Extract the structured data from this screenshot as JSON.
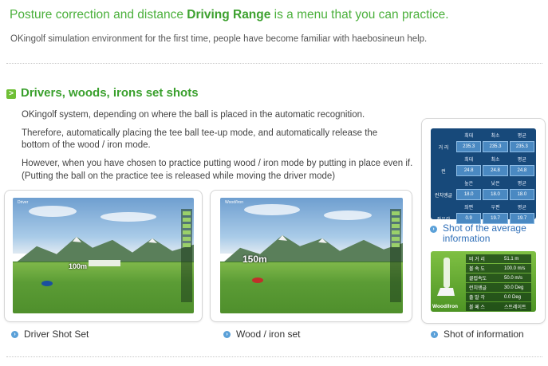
{
  "header": {
    "headline_pre": "Posture correction and distance ",
    "headline_bold": "Driving Range",
    "headline_post": " is a menu that you can practice.",
    "subline": "OKingolf simulation environment for the first time, people have become familiar with haebosineun help."
  },
  "section": {
    "icon": "arrow-right-icon",
    "icon_glyph": ">",
    "title": "Drivers, woods, irons set shots",
    "paragraphs": [
      "OKingolf system, depending on where the ball is placed in the automatic recognition.",
      "Therefore, automatically placing the tee ball tee-up mode, and automatically release the",
      "bottom of the wood / iron mode.",
      "However, when you have chosen to practice putting wood / iron mode by putting in place even if.",
      "(Putting the ball on the practice tee is released while moving the driver mode)"
    ]
  },
  "shots": [
    {
      "caption": "Driver Shot Set",
      "distance_label": "100m",
      "hud_label": "Driver"
    },
    {
      "caption": "Wood / iron set",
      "distance_label": "150m",
      "hud_label": "Wood/Iron"
    }
  ],
  "average": {
    "caption_line1": "Shot of the average",
    "caption_line2": "information",
    "col_headers": [
      "최대",
      "최소",
      "평균"
    ],
    "rows": [
      {
        "label": "거 리",
        "values": [
          "235.3",
          "235.3",
          "235.3"
        ]
      },
      {
        "label": "",
        "values": [
          "",
          "",
          ""
        ]
      },
      {
        "label": "런",
        "values": [
          "24.8",
          "24.8",
          "24.8"
        ]
      },
      {
        "label": "",
        "values": [
          "높은",
          "낮은",
          "평균"
        ]
      },
      {
        "label": "런치앵글",
        "values": [
          "18.0",
          "18.0",
          "18.0"
        ]
      },
      {
        "label": "",
        "values": [
          "좌편",
          "우편",
          "평균"
        ]
      },
      {
        "label": "좌우각",
        "values": [
          "0.9",
          "19.7",
          "19.7"
        ]
      }
    ]
  },
  "info": {
    "caption": "Shot of information",
    "club_label": "Wood/Iron",
    "rows": [
      {
        "label": "비 거 리",
        "value": "51.1 m"
      },
      {
        "label": "볼 속 도",
        "value": "100.0 m/s"
      },
      {
        "label": "클럽속도",
        "value": "50.0 m/s"
      },
      {
        "label": "런치앵글",
        "value": "30.0 Deg"
      },
      {
        "label": "출 발 각",
        "value": "0.0 Deg"
      },
      {
        "label": "볼 페 스",
        "value": "스트레이트"
      }
    ]
  },
  "colors": {
    "accent_green": "#3da12f",
    "link_blue": "#2f6fb8",
    "bullet_blue": "#5aa0d8"
  }
}
